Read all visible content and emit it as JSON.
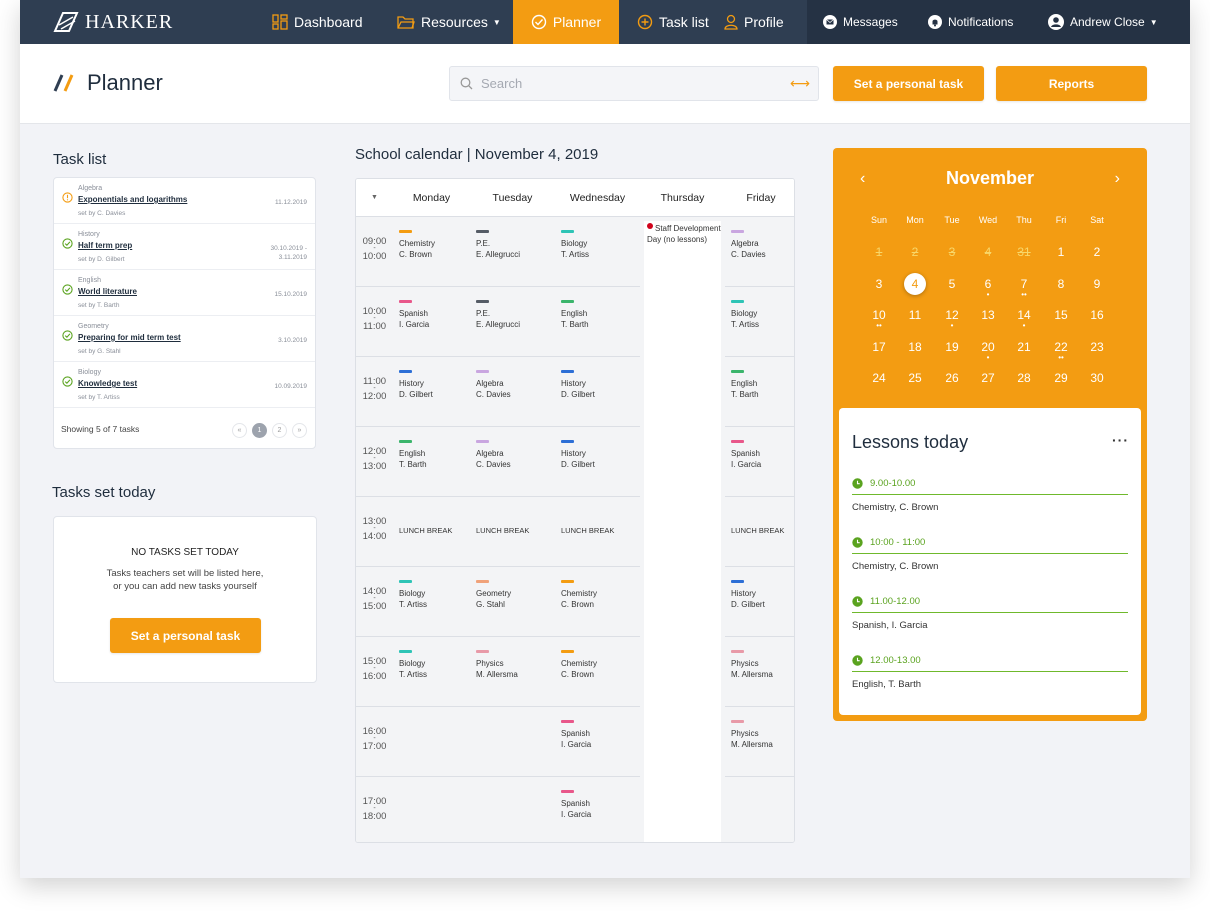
{
  "brand": {
    "name": "HARKER"
  },
  "nav": {
    "dashboard": "Dashboard",
    "resources": "Resources",
    "planner": "Planner",
    "tasklist": "Task list",
    "profile": "Profile",
    "messages": "Messages",
    "notifications": "Notifications",
    "user": "Andrew Close"
  },
  "header": {
    "title": "Planner",
    "search_placeholder": "Search",
    "set_task": "Set a personal task",
    "reports": "Reports"
  },
  "tasks": {
    "title": "Task list",
    "items": [
      {
        "subject": "Algebra",
        "name": "Exponentials and logarithms",
        "by": "set by C. Davies",
        "date": "11.12.2019",
        "status": "warning"
      },
      {
        "subject": "History",
        "name": "Half term prep",
        "by": "set by D. Gilbert",
        "date": "30.10.2019 -",
        "date2": "3.11.2019",
        "status": "done"
      },
      {
        "subject": "English",
        "name": "World literature",
        "by": "set by T. Barth",
        "date": "15.10.2019",
        "status": "done"
      },
      {
        "subject": "Geometry",
        "name": "Preparing for mid term test",
        "by": "set by G. Stahl",
        "date": "3.10.2019",
        "status": "done"
      },
      {
        "subject": "Biology",
        "name": "Knowledge test",
        "by": "set by T. Artiss",
        "date": "10.09.2019",
        "status": "done"
      }
    ],
    "showing": "Showing 5 of 7 tasks",
    "pages": [
      "«",
      "1",
      "2",
      "»"
    ]
  },
  "today": {
    "title": "Tasks set today",
    "none": "NO TASKS SET TODAY",
    "desc1": "Tasks teachers set will be listed here,",
    "desc2": "or you can add new tasks yourself",
    "button": "Set a personal task"
  },
  "schedule": {
    "title": "School calendar | November 4, 2019",
    "days": [
      "Monday",
      "Tuesday",
      "Wednesday",
      "Thursday",
      "Friday"
    ],
    "times": [
      [
        "09:00",
        "10:00"
      ],
      [
        "10:00",
        "11:00"
      ],
      [
        "11:00",
        "12:00"
      ],
      [
        "12:00",
        "13:00"
      ],
      [
        "13:00",
        "14:00"
      ],
      [
        "14:00",
        "15:00"
      ],
      [
        "15:00",
        "16:00"
      ],
      [
        "16:00",
        "17:00"
      ],
      [
        "17:00",
        "18:00"
      ]
    ],
    "thursday_note": "Staff Development Day (no lessons)",
    "lunch": "LUNCH BREAK",
    "colors": {
      "Chemistry": "#f39c12",
      "Spanish": "#e8578a",
      "History": "#2d6fd6",
      "English": "#3bb56c",
      "Biology": "#2ec4b6",
      "P.E.": "#555c66",
      "Algebra": "#c9a6e0",
      "Geometry": "#f0a27a",
      "Physics": "#e89aa8"
    },
    "grid": [
      [
        [
          "Chemistry",
          "C. Brown"
        ],
        [
          "Spanish",
          "I. Garcia"
        ],
        [
          "History",
          "D. Gilbert"
        ],
        [
          "English",
          "T. Barth"
        ],
        "LUNCH",
        [
          "Biology",
          "T. Artiss"
        ],
        [
          "Biology",
          "T. Artiss"
        ],
        null,
        null
      ],
      [
        [
          "P.E.",
          "E. Allegrucci"
        ],
        [
          "P.E.",
          "E. Allegrucci"
        ],
        [
          "Algebra",
          "C. Davies"
        ],
        [
          "Algebra",
          "C. Davies"
        ],
        "LUNCH",
        [
          "Geometry",
          "G. Stahl"
        ],
        [
          "Physics",
          "M. Allersma"
        ],
        null,
        null
      ],
      [
        [
          "Biology",
          "T. Artiss"
        ],
        [
          "English",
          "T. Barth"
        ],
        [
          "History",
          "D. Gilbert"
        ],
        [
          "History",
          "D. Gilbert"
        ],
        "LUNCH",
        [
          "Chemistry",
          "C. Brown"
        ],
        [
          "Chemistry",
          "C. Brown"
        ],
        [
          "Spanish",
          "I. Garcia"
        ],
        [
          "Spanish",
          "I. Garcia"
        ]
      ],
      null,
      [
        [
          "Algebra",
          "C. Davies"
        ],
        [
          "Biology",
          "T. Artiss"
        ],
        [
          "English",
          "T. Barth"
        ],
        [
          "Spanish",
          "I. Garcia"
        ],
        "LUNCH",
        [
          "History",
          "D. Gilbert"
        ],
        [
          "Physics",
          "M. Allersma"
        ],
        [
          "Physics",
          "M. Allersma"
        ],
        null
      ]
    ]
  },
  "calendar": {
    "month": "November",
    "weekdays": [
      "Sun",
      "Mon",
      "Tue",
      "Wed",
      "Thu",
      "Fri",
      "Sat"
    ],
    "weeks": [
      [
        {
          "d": "1",
          "p": true
        },
        {
          "d": "2",
          "p": true
        },
        {
          "d": "3",
          "p": true
        },
        {
          "d": "4",
          "p": true
        },
        {
          "d": "31",
          "p": true
        },
        {
          "d": "1"
        },
        {
          "d": "2"
        }
      ],
      [
        {
          "d": "3"
        },
        {
          "d": "4",
          "today": true
        },
        {
          "d": "5"
        },
        {
          "d": "6",
          "dots": "•"
        },
        {
          "d": "7",
          "dots": "••"
        },
        {
          "d": "8"
        },
        {
          "d": "9"
        }
      ],
      [
        {
          "d": "10",
          "dots": "••"
        },
        {
          "d": "11"
        },
        {
          "d": "12",
          "dots": "•"
        },
        {
          "d": "13"
        },
        {
          "d": "14",
          "dots": "•"
        },
        {
          "d": "15"
        },
        {
          "d": "16"
        }
      ],
      [
        {
          "d": "17"
        },
        {
          "d": "18"
        },
        {
          "d": "19"
        },
        {
          "d": "20",
          "dots": "•"
        },
        {
          "d": "21"
        },
        {
          "d": "22",
          "dots": "••"
        },
        {
          "d": "23"
        }
      ],
      [
        {
          "d": "24"
        },
        {
          "d": "25"
        },
        {
          "d": "26"
        },
        {
          "d": "27"
        },
        {
          "d": "28"
        },
        {
          "d": "29"
        },
        {
          "d": "30"
        }
      ]
    ]
  },
  "lessons": {
    "title": "Lessons today",
    "items": [
      {
        "time": "9.00-10.00",
        "who": "Chemistry, C. Brown"
      },
      {
        "time": "10:00 - 11:00",
        "who": "Chemistry, C. Brown"
      },
      {
        "time": "11.00-12.00",
        "who": "Spanish, I. Garcia"
      },
      {
        "time": "12.00-13.00",
        "who": "English, T. Barth"
      }
    ]
  }
}
